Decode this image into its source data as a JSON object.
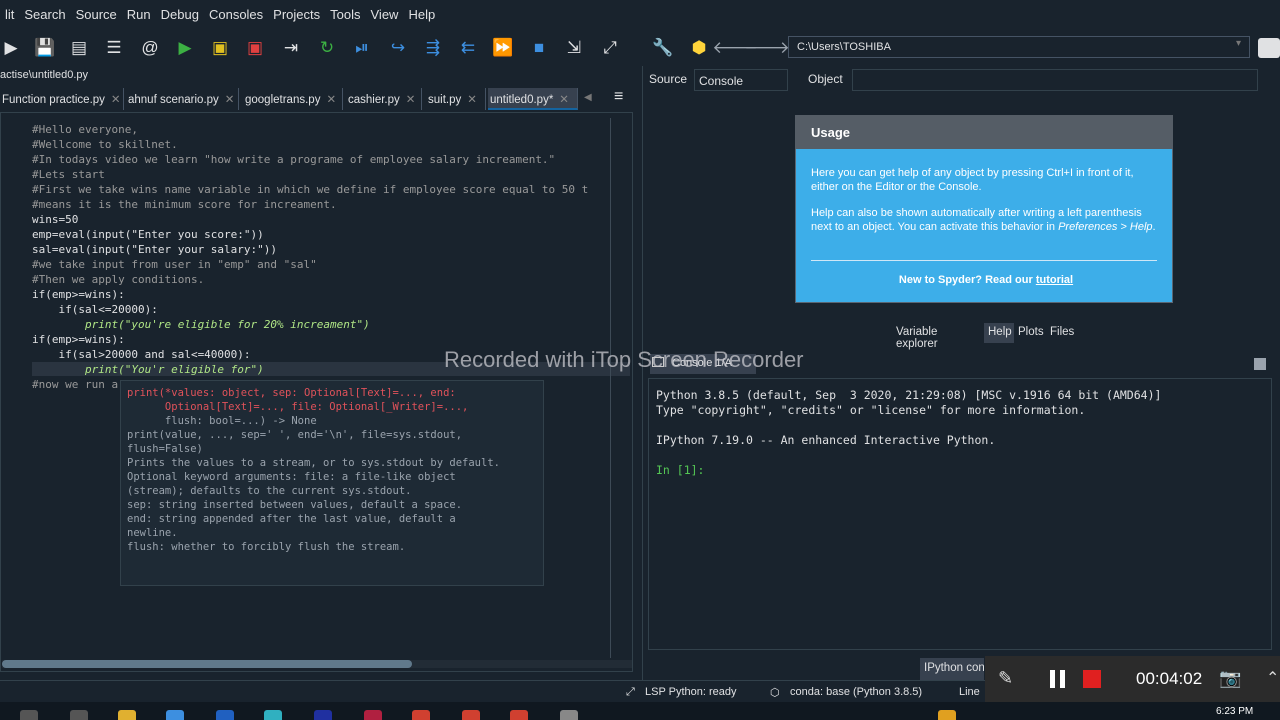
{
  "menu": [
    "lit",
    "Search",
    "Source",
    "Run",
    "Debug",
    "Consoles",
    "Projects",
    "Tools",
    "View",
    "Help"
  ],
  "toolbar": {
    "path": "C:\\Users\\TOSHIBA",
    "icons": [
      "new-file-icon",
      "save-icon",
      "save-all-icon",
      "list-icon",
      "at-icon",
      "run-icon",
      "run-cell-icon",
      "run-cell-advance-icon",
      "run-selection-icon",
      "rerun-icon",
      "debug-icon",
      "step-icon",
      "step-into-icon",
      "step-return-icon",
      "continue-icon",
      "stop-debug-icon",
      "maximize-pane-icon",
      "fullscreen-icon",
      "tools-icon",
      "python-icon",
      "back-arrow-icon",
      "forward-arrow-icon"
    ]
  },
  "editor": {
    "path": "actise\\untitled0.py",
    "tabs": [
      {
        "label": "Function practice.py",
        "active": false
      },
      {
        "label": "ahnuf scenario.py",
        "active": false
      },
      {
        "label": "googletrans.py",
        "active": false
      },
      {
        "label": "cashier.py",
        "active": false
      },
      {
        "label": "suit.py",
        "active": false
      },
      {
        "label": "untitled0.py*",
        "active": true
      }
    ],
    "code": [
      "#Hello everyone,",
      "#Wellcome to skillnet.",
      "#In todays video we learn \"how write a programe of employee salary increament.\"",
      "#Lets start",
      "#First we take wins name variable in which we define if employee score equal to 50 t",
      "#means it is the minimum score for increament.",
      "wins=50",
      "emp=eval(input(\"Enter you score:\"))",
      "sal=eval(input(\"Enter your salary:\"))",
      "#we take input from user in \"emp\" and \"sal\"",
      "#Then we apply conditions.",
      "if(emp>=wins):",
      "    if(sal<=20000):",
      "        print(\"you're eligible for 20% increament\")",
      "if(emp>=wins):",
      "    if(sal>20000 and sal<=40000):",
      "        print(\"You'r eligible for\")",
      "#now we run a"
    ],
    "tooltip": [
      "print(*values: object, sep: Optional[Text]=..., end:",
      "      Optional[Text]=..., file: Optional[_Writer]=...,",
      "      flush: bool=...) -> None",
      "",
      "print(value, ..., sep=' ', end='\\n', file=sys.stdout,",
      "flush=False)",
      "",
      "Prints the values to a stream, or to sys.stdout by default.",
      "Optional keyword arguments: file: a file-like object",
      "(stream); defaults to the current sys.stdout.",
      "sep: string inserted between values, default a space.",
      "end: string appended after the last value, default a",
      "newline.",
      "flush: whether to forcibly flush the stream."
    ]
  },
  "help": {
    "source_label": "Source",
    "console_select": "Console",
    "object_label": "Object",
    "usage_title": "Usage",
    "usage_p1": "Here you can get help of any object by pressing Ctrl+I in front of it, either on the Editor or the Console.",
    "usage_p2a": "Help can also be shown automatically after writing a left parenthesis next to an object. You can activate this behavior in ",
    "usage_p2b": "Preferences > Help",
    "usage_p2c": ".",
    "usage_p3a": "New to Spyder? Read our ",
    "usage_p3b": "tutorial",
    "tabs": [
      "Variable explorer",
      "Help",
      "Plots",
      "Files"
    ]
  },
  "watermark": "Recorded with iTop Screen Recorder",
  "console": {
    "tab": "Console 1/A",
    "lines": [
      "Python 3.8.5 (default, Sep  3 2020, 21:29:08) [MSC v.1916 64 bit (AMD64)]",
      "Type \"copyright\", \"credits\" or \"license\" for more information.",
      "",
      "IPython 7.19.0 -- An enhanced Interactive Python.",
      ""
    ],
    "prompt": "In [1]:",
    "bottom_tab": "IPython console"
  },
  "status": {
    "lsp": "LSP Python: ready",
    "conda": "conda: base (Python 3.8.5)",
    "line": "Line"
  },
  "recorder": {
    "time": "00:04:02"
  },
  "taskbar": {
    "clock": "6:23 PM"
  },
  "colors": {
    "usage_bg": "#3daee9",
    "prompt": "#54c654",
    "stop": "#e02020"
  }
}
